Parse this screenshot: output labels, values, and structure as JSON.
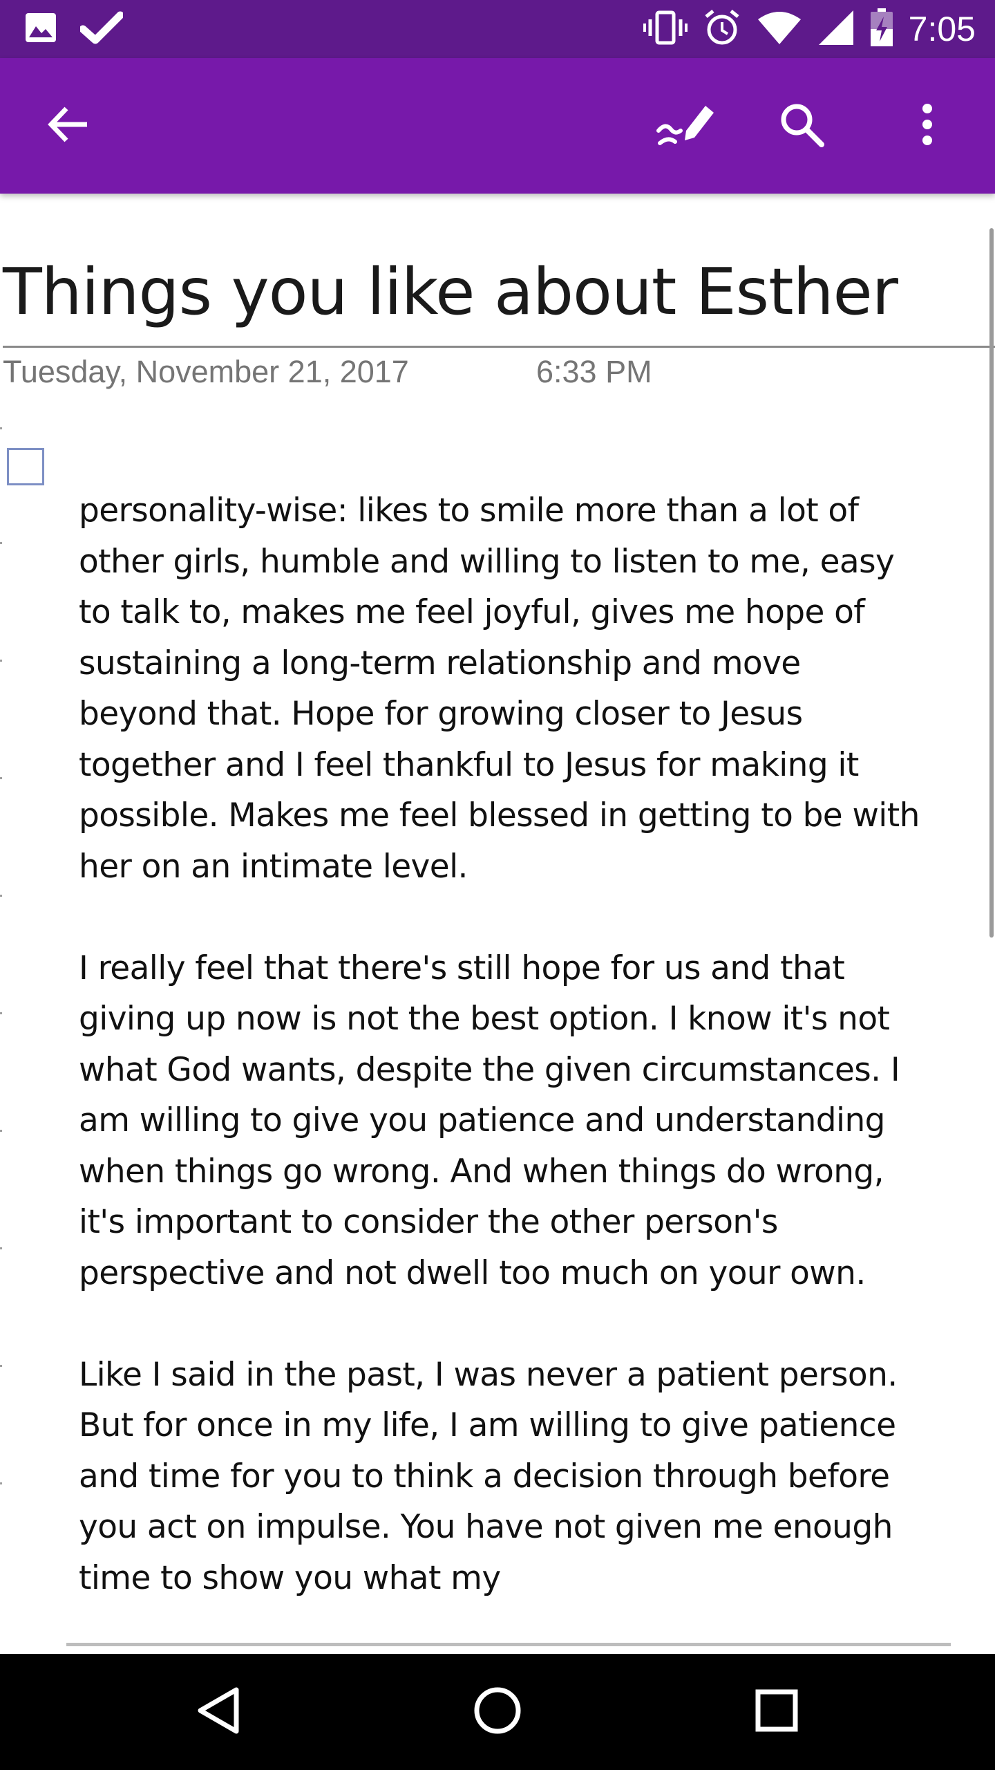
{
  "status_bar": {
    "time": "7:05",
    "left_icons": [
      "image-icon",
      "check-icon"
    ],
    "right_icons": [
      "vibrate-icon",
      "alarm-icon",
      "wifi-icon",
      "signal-icon",
      "battery-charging-icon"
    ],
    "background": "#5e1a8b"
  },
  "app_bar": {
    "background": "#7719aa",
    "actions": [
      "back-arrow-icon",
      "draw-pen-icon",
      "search-icon",
      "more-vert-icon"
    ]
  },
  "page": {
    "title": "Things you like about Esther",
    "date": "Tuesday, November 21, 2017",
    "time": "6:33 PM",
    "paragraphs": [
      "personality-wise: likes to smile more than a lot of other girls, humble and willing to listen to me, easy to talk to, makes me feel joyful, gives me hope of sustaining a long-term relationship and move beyond that. Hope for growing closer to Jesus together and I feel thankful to Jesus for making it possible. Makes me feel blessed in getting to be with her on an intimate level.",
      "I really feel that there's still hope for us and that giving up now is not the best option. I know it's not what God wants, despite the given circumstances. I am willing to give you patience and understanding when things go wrong. And when things do wrong, it's important to consider the other person's perspective and not dwell too much on your own.",
      "Like I said in the past, I was never a patient person. But for once in my life, I am willing to give patience and time for you to think a decision through before you act on impulse. You have not given me enough time to show you what my"
    ]
  },
  "nav_bar": {
    "buttons": [
      "back-triangle-icon",
      "home-circle-icon",
      "recents-square-icon"
    ]
  }
}
